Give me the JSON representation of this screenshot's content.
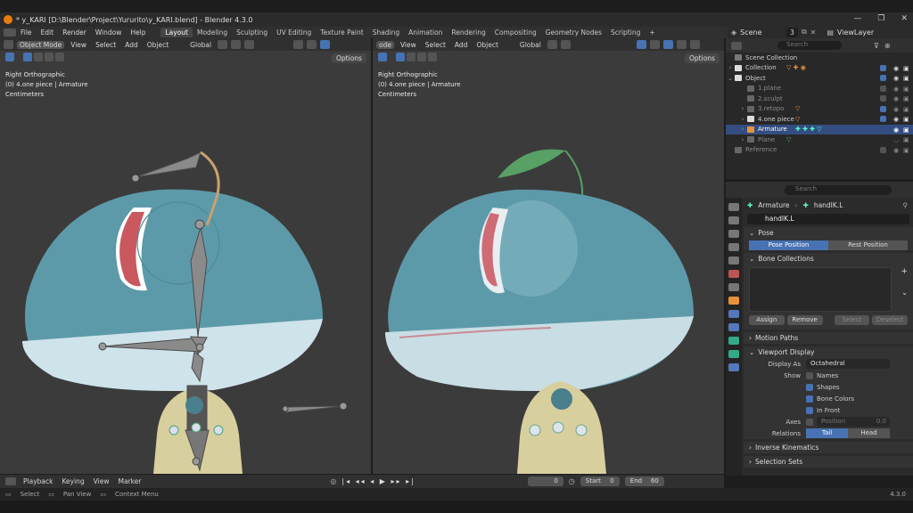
{
  "window": {
    "title": "* y_KARI [D:\\Blender\\Project\\Yururito\\y_KARI.blend] - Blender 4.3.0"
  },
  "menus": [
    "File",
    "Edit",
    "Render",
    "Window",
    "Help"
  ],
  "workspaces": [
    "Layout",
    "Modeling",
    "Sculpting",
    "UV Editing",
    "Texture Paint",
    "Shading",
    "Animation",
    "Rendering",
    "Compositing",
    "Geometry Nodes",
    "Scripting"
  ],
  "active_workspace": "Layout",
  "scene": {
    "label": "Scene",
    "count": "3",
    "view_layer": "ViewLayer"
  },
  "viewport_left": {
    "mode": "Object Mode",
    "menu": [
      "View",
      "Select",
      "Add",
      "Object"
    ],
    "orientation": "Global",
    "options": "Options",
    "info": [
      "Right Orthographic",
      "(0) 4.one piece | Armature",
      "Centimeters"
    ]
  },
  "viewport_right": {
    "mode": "ode",
    "menu": [
      "View",
      "Select",
      "Add",
      "Object"
    ],
    "orientation": "Global",
    "options": "Options",
    "info": [
      "Right Orthographic",
      "(0) 4.one piece | Armature",
      "Centimeters"
    ]
  },
  "outliner": {
    "search_placeholder": "Search",
    "rows": [
      {
        "label": "Scene Collection",
        "indent": 0
      },
      {
        "label": "Collection",
        "indent": 1
      },
      {
        "label": "Object",
        "indent": 1
      },
      {
        "label": "1.plane",
        "indent": 2
      },
      {
        "label": "2.sculpt",
        "indent": 2
      },
      {
        "label": "3.retopo",
        "indent": 2
      },
      {
        "label": "4.one piece",
        "indent": 2
      },
      {
        "label": "Armature",
        "indent": 2
      },
      {
        "label": "Plane",
        "indent": 2
      },
      {
        "label": "Reference",
        "indent": 1
      }
    ]
  },
  "properties": {
    "search_placeholder": "Search",
    "breadcrumb": {
      "object": "Armature",
      "bone": "handIK.L"
    },
    "bone_name": "handIK.L",
    "pose": {
      "title": "Pose",
      "pose_position": "Pose Position",
      "rest_position": "Rest Position"
    },
    "bone_collections": {
      "title": "Bone Collections",
      "assign": "Assign",
      "remove": "Remove",
      "select": "Select",
      "deselect": "Deselect"
    },
    "motion_paths": "Motion Paths",
    "viewport_display": {
      "title": "Viewport Display",
      "display_as_label": "Display As",
      "display_as_value": "Octahedral",
      "show_label": "Show",
      "names": "Names",
      "shapes": "Shapes",
      "bone_colors": "Bone Colors",
      "in_front": "In Front",
      "axes_label": "Axes",
      "position_label": "Position",
      "position_value": "0.0",
      "relations_label": "Relations",
      "tail": "Tail",
      "head": "Head"
    },
    "inverse_kinematics": "Inverse Kinematics",
    "selection_sets": "Selection Sets"
  },
  "timeline": {
    "menu": [
      "Playback",
      "Keying",
      "View",
      "Marker"
    ],
    "current_frame": "0",
    "start_label": "Start",
    "start": "0",
    "end_label": "End",
    "end": "60"
  },
  "statusbar": {
    "items": [
      "Select",
      "Pan View",
      "Context Menu"
    ],
    "version": "4.3.0"
  }
}
